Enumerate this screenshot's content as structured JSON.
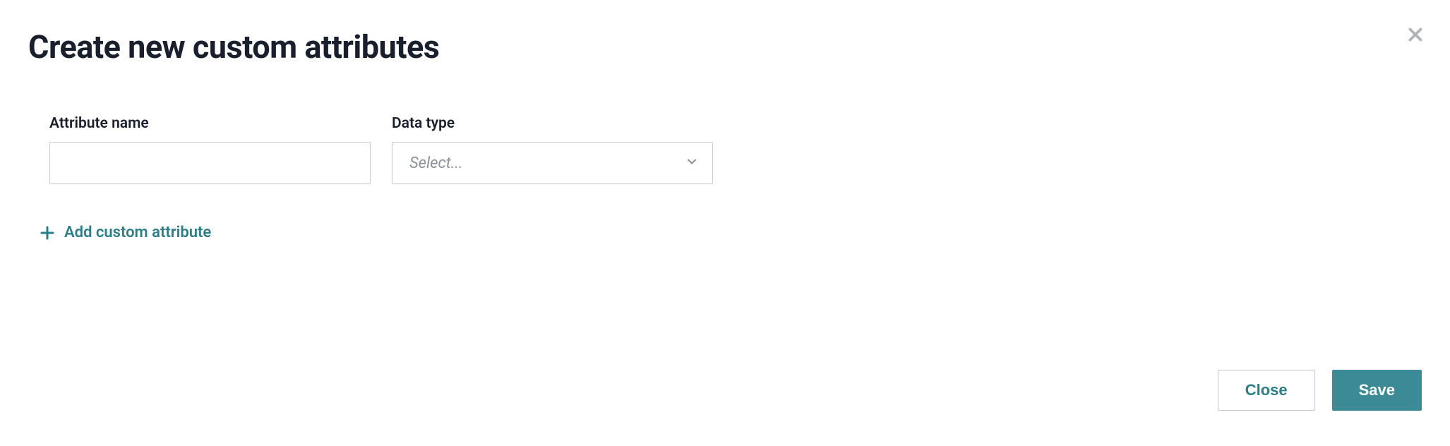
{
  "modal": {
    "title": "Create new custom attributes"
  },
  "form": {
    "attribute_name": {
      "label": "Attribute name",
      "value": ""
    },
    "data_type": {
      "label": "Data type",
      "placeholder": "Select..."
    }
  },
  "actions": {
    "add_link": "Add custom attribute",
    "close": "Close",
    "save": "Save"
  }
}
